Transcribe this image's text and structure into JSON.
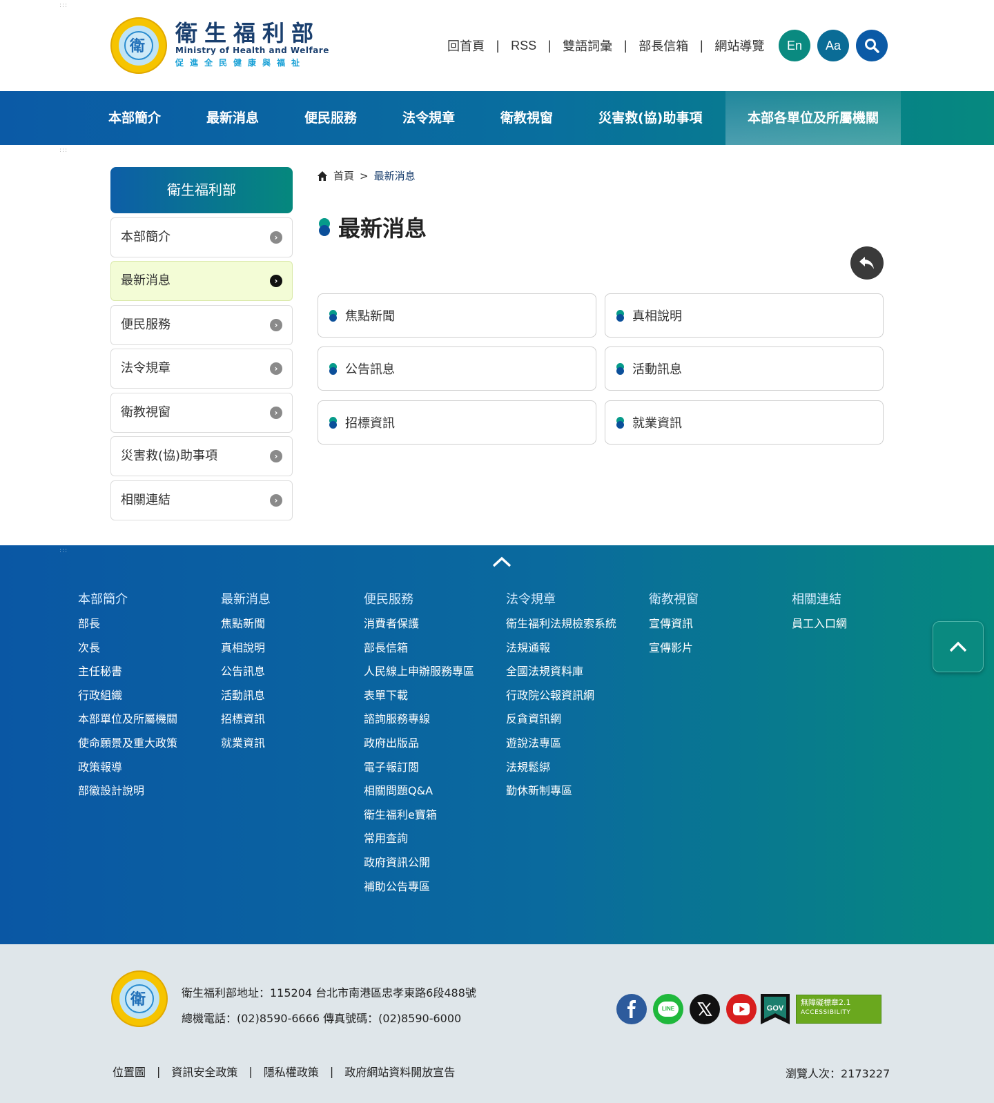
{
  "header": {
    "logo_cn": "衛生福利部",
    "logo_en": "Ministry of Health and Welfare",
    "logo_slogan": "促進全民健康與福祉",
    "top_links": [
      "回首頁",
      "RSS",
      "雙語詞彙",
      "部長信箱",
      "網站導覽"
    ],
    "en_label": "En",
    "font_label": "Aa",
    "search_icon": "search-icon"
  },
  "nav": [
    "本部簡介",
    "最新消息",
    "便民服務",
    "法令規章",
    "衛教視窗",
    "災害救(協)助事項",
    "本部各單位及所屬機關"
  ],
  "sidebar": {
    "title": "衛生福利部",
    "items": [
      {
        "label": "本部簡介",
        "active": false
      },
      {
        "label": "最新消息",
        "active": true
      },
      {
        "label": "便民服務",
        "active": false
      },
      {
        "label": "法令規章",
        "active": false
      },
      {
        "label": "衛教視窗",
        "active": false
      },
      {
        "label": "災害救(協)助事項",
        "active": false
      },
      {
        "label": "相關連結",
        "active": false
      }
    ]
  },
  "breadcrumb": {
    "home": "首頁",
    "sep": ">",
    "current": "最新消息"
  },
  "main": {
    "title": "最新消息",
    "cards": [
      "焦點新聞",
      "真相說明",
      "公告訊息",
      "活動訊息",
      "招標資訊",
      "就業資訊"
    ]
  },
  "footer_menu": {
    "columns": [
      {
        "head": "本部簡介",
        "links": [
          "部長",
          "次長",
          "主任秘書",
          "行政組織",
          "本部單位及所屬機關",
          "使命願景及重大政策",
          "政策報導",
          "部徽設計說明"
        ]
      },
      {
        "head": "最新消息",
        "links": [
          "焦點新聞",
          "真相說明",
          "公告訊息",
          "活動訊息",
          "招標資訊",
          "就業資訊"
        ]
      },
      {
        "head": "便民服務",
        "links": [
          "消費者保護",
          "部長信箱",
          "人民線上申辦服務專區",
          "表單下載",
          "諮詢服務專線",
          "政府出版品",
          "電子報訂閱",
          "相關問題Q&A",
          "衛生福利e寶箱",
          "常用查詢",
          "政府資訊公開",
          "補助公告專區"
        ]
      },
      {
        "head": "法令規章",
        "links": [
          "衛生福利法規檢索系統",
          "法規通報",
          "全國法規資料庫",
          "行政院公報資訊網",
          "反貪資訊網",
          "遊說法專區",
          "法規鬆綁",
          "勤休新制專區"
        ]
      },
      {
        "head": "衛教視窗",
        "links": [
          "宣傳資訊",
          "宣傳影片"
        ]
      },
      {
        "head": "相關連結",
        "links": [
          "員工入口網"
        ]
      }
    ]
  },
  "bottom": {
    "address": "衛生福利部地址：115204 台北市南港區忠孝東路6段488號",
    "phone": "總機電話：(02)8590-6666 傳真號碼：(02)8590-6000",
    "links": [
      "位置圖",
      "資訊安全政策",
      "隱私權政策",
      "政府網站資料開放宣告"
    ],
    "visits": "瀏覽人次：2173227",
    "gov_label": "GOV",
    "acc_title": "無障礙標章2.1",
    "acc_sub": "ACCESSIBILITY",
    "line_label": "LINE"
  },
  "colors": {
    "primary_blue": "#0b5aa6",
    "primary_teal": "#06897f",
    "en_btn": "#0a8a80",
    "aa_btn": "#0a6c96",
    "search_btn": "#0b5aa6"
  }
}
